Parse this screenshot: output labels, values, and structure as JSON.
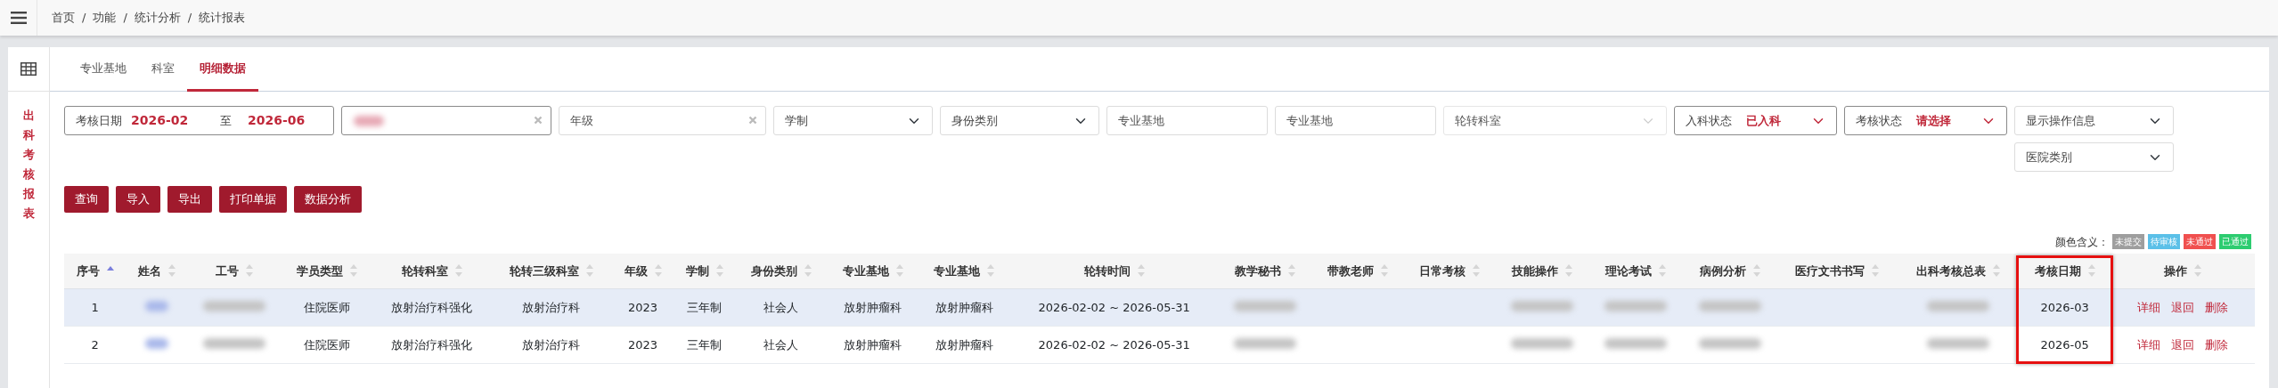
{
  "breadcrumb": [
    "首页",
    "功能",
    "统计分析",
    "统计报表"
  ],
  "breadcrumb_separator": "/",
  "side_title": "出科考核报表",
  "tabs": [
    {
      "label": "专业基地",
      "selected": false
    },
    {
      "label": "科室",
      "selected": false
    },
    {
      "label": "明细数据",
      "selected": true
    }
  ],
  "filters": [
    {
      "kind": "date-range",
      "label": "考核日期",
      "from": "2026-02",
      "to_label": "至",
      "to": "2026-06"
    },
    {
      "kind": "blurred-clear"
    },
    {
      "kind": "text-clear",
      "placeholder": "年级"
    },
    {
      "kind": "select",
      "placeholder": "学制"
    },
    {
      "kind": "select",
      "placeholder": "身份类别"
    },
    {
      "kind": "input",
      "placeholder": "专业基地"
    },
    {
      "kind": "input",
      "placeholder": "专业基地"
    },
    {
      "kind": "select-disabled",
      "placeholder": "轮转科室"
    },
    {
      "kind": "labeled-select",
      "label": "入科状态",
      "value": "已入科"
    },
    {
      "kind": "labeled-select",
      "label": "考核状态",
      "value": "请选择"
    },
    {
      "kind": "select",
      "placeholder": "显示操作信息"
    }
  ],
  "secondary_filters": [
    {
      "kind": "select",
      "placeholder": "医院类别"
    }
  ],
  "buttons": [
    "查询",
    "导入",
    "导出",
    "打印单据",
    "数据分析"
  ],
  "legend": {
    "label": "颜色含义：",
    "items": [
      {
        "label": "未提交",
        "color": "#9e9e9e"
      },
      {
        "label": "待审核",
        "color": "#5bc0e8"
      },
      {
        "label": "未通过",
        "color": "#f0504f"
      },
      {
        "label": "已通过",
        "color": "#2dcc70"
      }
    ]
  },
  "table": {
    "columns": [
      {
        "label": "序号",
        "sorted": true,
        "highlighted": false
      },
      {
        "label": "姓名",
        "sorted": false,
        "highlighted": false
      },
      {
        "label": "工号",
        "sorted": false,
        "highlighted": false
      },
      {
        "label": "学员类型",
        "sorted": false,
        "highlighted": false
      },
      {
        "label": "轮转科室",
        "sorted": false,
        "highlighted": false
      },
      {
        "label": "轮转三级科室",
        "sorted": false,
        "highlighted": false
      },
      {
        "label": "年级",
        "sorted": false,
        "highlighted": false
      },
      {
        "label": "学制",
        "sorted": false,
        "highlighted": false
      },
      {
        "label": "身份类别",
        "sorted": false,
        "highlighted": false
      },
      {
        "label": "专业基地",
        "sorted": false,
        "highlighted": false
      },
      {
        "label": "专业基地",
        "sorted": false,
        "highlighted": false
      },
      {
        "label": "轮转时间",
        "sorted": false,
        "highlighted": false
      },
      {
        "label": "教学秘书",
        "sorted": false,
        "highlighted": false
      },
      {
        "label": "带教老师",
        "sorted": false,
        "highlighted": false
      },
      {
        "label": "日常考核",
        "sorted": false,
        "highlighted": false
      },
      {
        "label": "技能操作",
        "sorted": false,
        "highlighted": false
      },
      {
        "label": "理论考试",
        "sorted": false,
        "highlighted": false
      },
      {
        "label": "病例分析",
        "sorted": false,
        "highlighted": false
      },
      {
        "label": "医疗文书书写",
        "sorted": false,
        "highlighted": false
      },
      {
        "label": "出科考核总表",
        "sorted": false,
        "highlighted": false
      },
      {
        "label": "考核日期",
        "sorted": false,
        "highlighted": true
      },
      {
        "label": "操作",
        "sorted": false,
        "highlighted": false
      }
    ],
    "rows": [
      {
        "highlighted": true,
        "cells": [
          {
            "kind": "text",
            "text": "1"
          },
          {
            "kind": "blurred-link"
          },
          {
            "kind": "blurred"
          },
          {
            "kind": "text",
            "text": "住院医师"
          },
          {
            "kind": "text",
            "text": "放射治疗科强化"
          },
          {
            "kind": "text",
            "text": "放射治疗科"
          },
          {
            "kind": "text",
            "text": "2023"
          },
          {
            "kind": "text",
            "text": "三年制"
          },
          {
            "kind": "text",
            "text": "社会人"
          },
          {
            "kind": "text",
            "text": "放射肿瘤科"
          },
          {
            "kind": "text",
            "text": "放射肿瘤科"
          },
          {
            "kind": "text",
            "text": "2026-02-02 ~ 2026-05-31"
          },
          {
            "kind": "blurred"
          },
          {
            "kind": "empty"
          },
          {
            "kind": "empty"
          },
          {
            "kind": "blurred"
          },
          {
            "kind": "blurred"
          },
          {
            "kind": "blurred"
          },
          {
            "kind": "empty"
          },
          {
            "kind": "blurred"
          },
          {
            "kind": "text",
            "text": "2026-03"
          },
          {
            "kind": "actions",
            "actions": [
              "详细",
              "退回",
              "删除"
            ]
          }
        ]
      },
      {
        "highlighted": false,
        "cells": [
          {
            "kind": "text",
            "text": "2"
          },
          {
            "kind": "blurred-link"
          },
          {
            "kind": "blurred"
          },
          {
            "kind": "text",
            "text": "住院医师"
          },
          {
            "kind": "text",
            "text": "放射治疗科强化"
          },
          {
            "kind": "text",
            "text": "放射治疗科"
          },
          {
            "kind": "text",
            "text": "2023"
          },
          {
            "kind": "text",
            "text": "三年制"
          },
          {
            "kind": "text",
            "text": "社会人"
          },
          {
            "kind": "text",
            "text": "放射肿瘤科"
          },
          {
            "kind": "text",
            "text": "放射肿瘤科"
          },
          {
            "kind": "text",
            "text": "2026-02-02 ~ 2026-05-31"
          },
          {
            "kind": "blurred"
          },
          {
            "kind": "empty"
          },
          {
            "kind": "empty"
          },
          {
            "kind": "blurred"
          },
          {
            "kind": "blurred"
          },
          {
            "kind": "blurred"
          },
          {
            "kind": "empty"
          },
          {
            "kind": "blurred"
          },
          {
            "kind": "text",
            "text": "2026-05"
          },
          {
            "kind": "actions",
            "actions": [
              "详细",
              "退回",
              "删除"
            ]
          }
        ]
      }
    ]
  }
}
